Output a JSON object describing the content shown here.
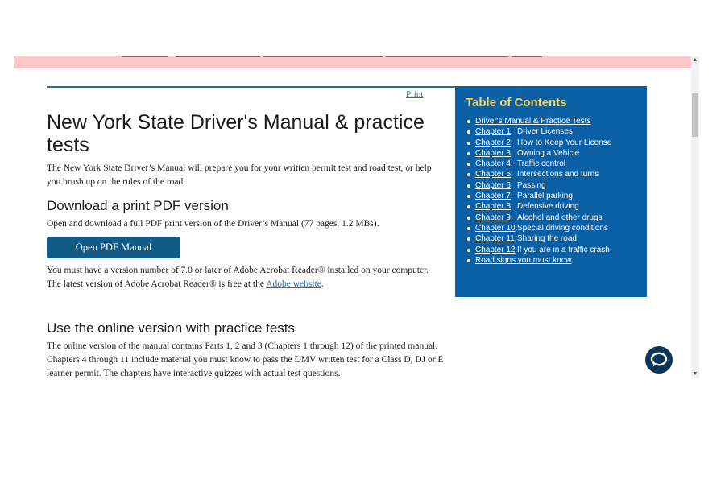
{
  "print_label": "Print",
  "title": "New York State Driver's Manual & practice tests",
  "intro": "The New York State Driver’s Manual will prepare you for your written permit test and road test, or help you brush up on the rules of the road.",
  "download": {
    "heading": "Download a print PDF version",
    "text": "Open and download a full PDF print version of the Driver’s Manual (77 pages, 1.2 MBs).",
    "button_label": "Open PDF Manual",
    "acrobat_text_before": "You must have a version number of 7.0 or later of Adobe Acrobat Reader® installed on your computer. The latest version of Adobe Acrobat Reader® is free at the ",
    "acrobat_link": "Adobe website",
    "acrobat_text_after": "."
  },
  "online": {
    "heading": "Use the online version with practice tests",
    "text": "The online version of the manual contains Parts 1, 2 and 3 (Chapters 1 through 12) of the printed manual. Chapters 4 through 11 include material you must know to pass the DMV written test for a Class D, DJ or E learner permit. The chapters have interactive quizzes with actual test questions."
  },
  "toc": {
    "title": "Table of Contents",
    "first_item": "Driver's Manual & Practice Tests",
    "chapters": [
      {
        "ch": "Chapter 1",
        "sep": ":",
        "name": "Driver Licenses"
      },
      {
        "ch": "Chapter 2",
        "sep": ":",
        "name": "How to Keep Your License"
      },
      {
        "ch": "Chapter 3",
        "sep": ":",
        "name": "Owning a Vehicle"
      },
      {
        "ch": "Chapter 4",
        "sep": ":",
        "name": "Traffic control"
      },
      {
        "ch": "Chapter 5",
        "sep": ":",
        "name": "Intersections and turns"
      },
      {
        "ch": "Chapter 6",
        "sep": ":",
        "name": "Passing"
      },
      {
        "ch": "Chapter 7",
        "sep": ":",
        "name": "Parallel parking"
      },
      {
        "ch": "Chapter 8",
        "sep": ":",
        "name": "Defensive driving"
      },
      {
        "ch": "Chapter 9",
        "sep": ":",
        "name": "Alcohol and other drugs"
      },
      {
        "ch": "Chapter 10",
        "sep": ":",
        "name": "Special driving conditions"
      },
      {
        "ch": "Chapter 11",
        "sep": ":",
        "name": "Sharing the road"
      },
      {
        "ch": "Chapter 12",
        "sep": ":",
        "name": "If you are in a traffic crash"
      }
    ],
    "last_item": "Road signs you must know"
  },
  "colors": {
    "toc_background": "#0b5fa5",
    "toc_title": "#f7d35a",
    "button": "#135b87",
    "link": "#1a6fb5",
    "top_bar": "#ffc7c7",
    "chat_button": "#0b3557"
  },
  "icons": {
    "chat": "chat-bubble-icon",
    "scroll_up": "triangle-up-icon",
    "scroll_down": "triangle-down-icon"
  }
}
